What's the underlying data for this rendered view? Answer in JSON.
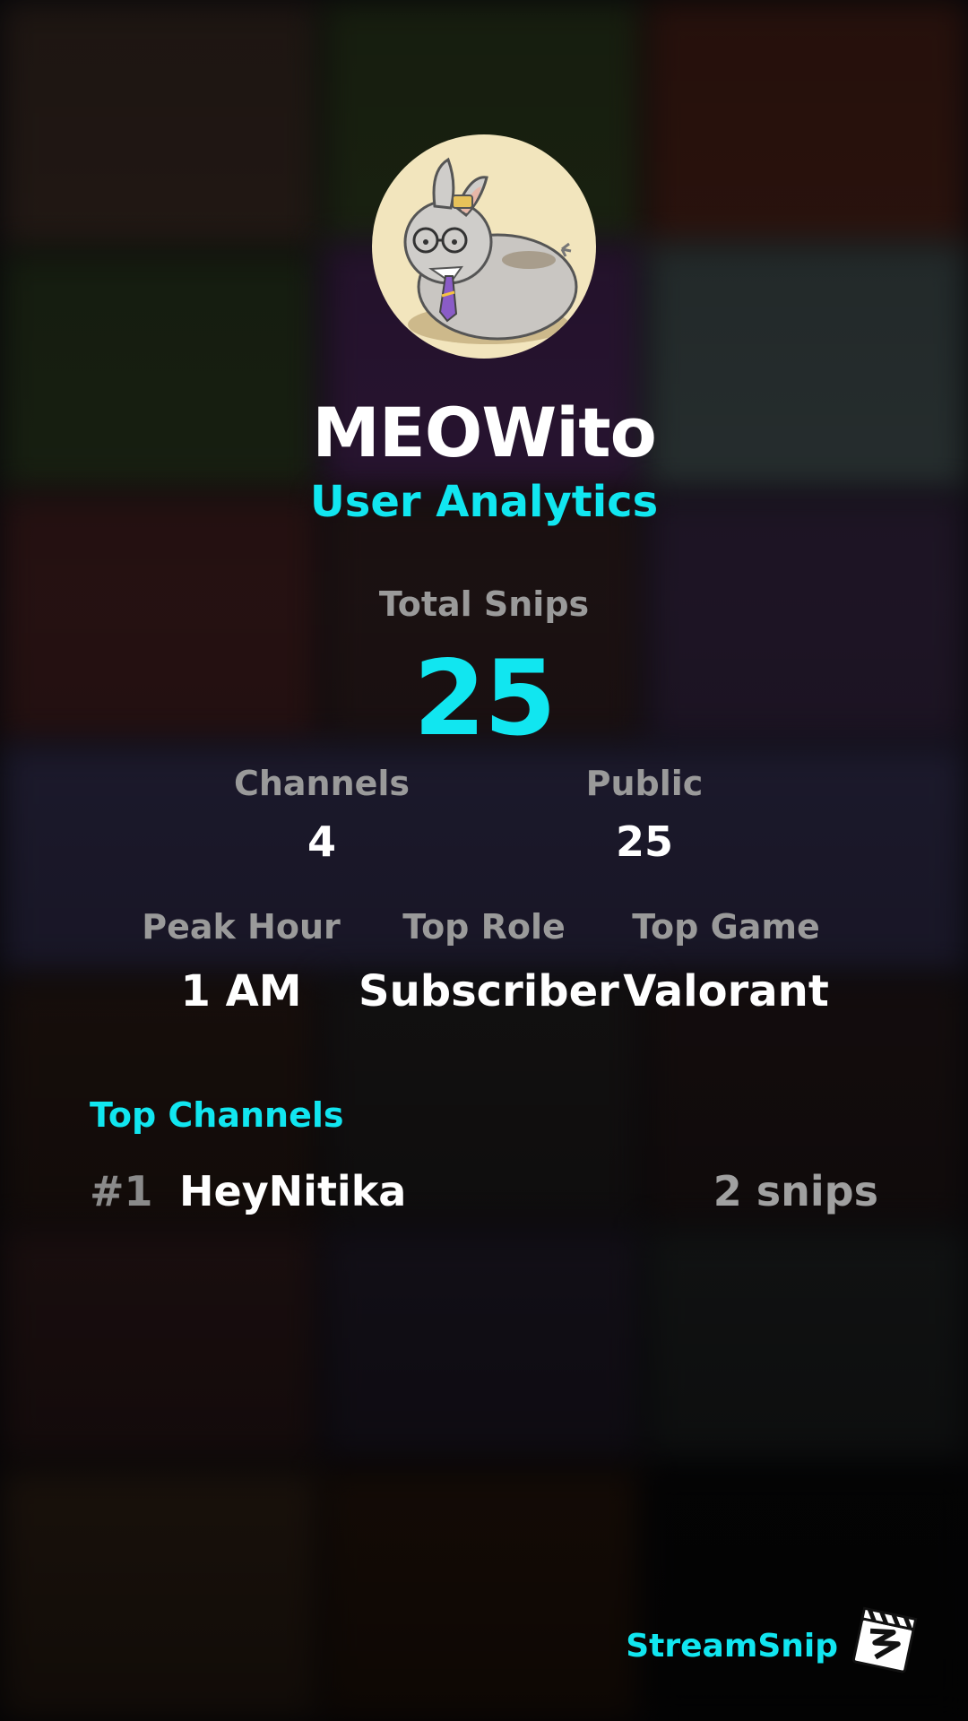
{
  "profile": {
    "username": "MEOWito",
    "subtitle": "User Analytics",
    "avatar_icon": "rabbit-with-glasses-and-tie-avatar"
  },
  "summary": {
    "total_label": "Total Snips",
    "total_value": "25"
  },
  "stats_row1": [
    {
      "label": "Channels",
      "value": "4"
    },
    {
      "label": "Public",
      "value": "25"
    }
  ],
  "stats_row2": [
    {
      "label": "Peak Hour",
      "value": "1 AM"
    },
    {
      "label": "Top Role",
      "value": "Subscriber"
    },
    {
      "label": "Top Game",
      "value": "Valorant"
    }
  ],
  "top_channels": {
    "title": "Top Channels",
    "items": [
      {
        "rank": "#1",
        "name": "HeyNitika",
        "count": "2 snips"
      }
    ]
  },
  "branding": {
    "name": "StreamSnip",
    "logo_icon": "clapperboard-logo-icon"
  },
  "colors": {
    "accent": "#11e6f0",
    "label_gray": "#9a9a9a",
    "text_white": "#ffffff",
    "avatar_bg": "#f2e5bd"
  }
}
